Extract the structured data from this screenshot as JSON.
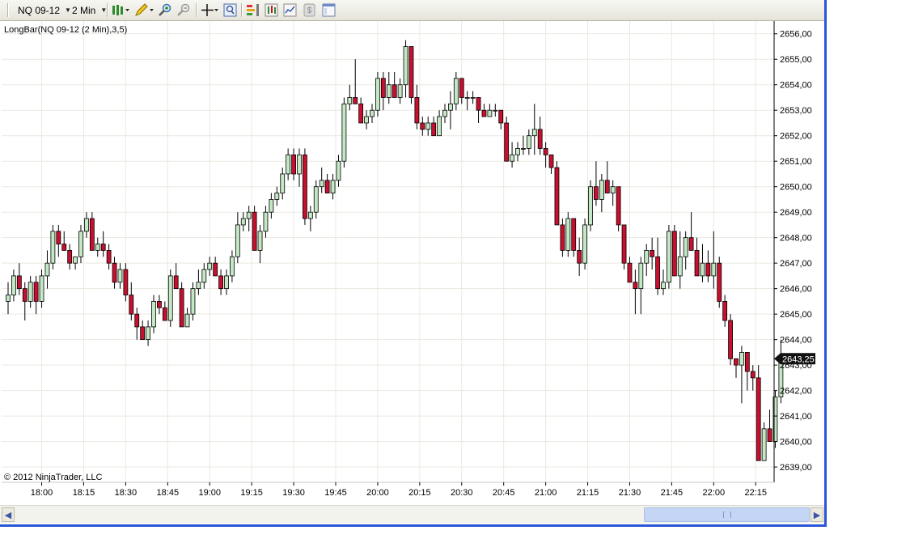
{
  "toolbar": {
    "instrument": "NQ 09-12",
    "interval": "2 Min",
    "icons": [
      "bar-type-icon",
      "drawing-pencil-icon",
      "zoom-in-icon",
      "zoom-out-icon",
      "crosshair-icon",
      "data-box-icon",
      "strategies-icon",
      "indicators-icon",
      "chart-style-icon",
      "price-marker-icon",
      "properties-icon"
    ]
  },
  "chart": {
    "indicator_label": "LongBar(NQ 09-12 (2 Min),3,5)",
    "copyright": "© 2012 NinjaTrader, LLC",
    "last_price": "2643,25",
    "colors": {
      "up": "#c4e8c4",
      "down": "#c8102e",
      "grid": "#e9e9e1",
      "last_price_bg": "#111111"
    }
  },
  "chart_data": {
    "type": "candlestick",
    "ylim": [
      2638.4,
      2656.5
    ],
    "y_ticks": [
      "2656,00",
      "2655,00",
      "2654,00",
      "2653,00",
      "2652,00",
      "2651,00",
      "2650,00",
      "2649,00",
      "2648,00",
      "2647,00",
      "2646,00",
      "2645,00",
      "2644,00",
      "2643,00",
      "2642,00",
      "2641,00",
      "2640,00",
      "2639,00"
    ],
    "x_ticks": [
      "18:00",
      "18:15",
      "18:30",
      "18:45",
      "19:00",
      "19:15",
      "19:30",
      "19:45",
      "20:00",
      "20:15",
      "20:30",
      "20:45",
      "21:00",
      "21:15",
      "21:30",
      "21:45",
      "22:00",
      "22:15"
    ],
    "x_tick_values": [
      0,
      7.5,
      15,
      22.5,
      30,
      37.5,
      45,
      52.5,
      60,
      67.5,
      75,
      82.5,
      90,
      97.5,
      105,
      112.5,
      120,
      127.5
    ],
    "x_range": [
      -6,
      130.5
    ],
    "candles": [
      [
        -6,
        2645.5,
        2646.25,
        2645.0,
        2645.75
      ],
      [
        -5,
        2645.75,
        2646.75,
        2645.5,
        2646.5
      ],
      [
        -4,
        2646.5,
        2647.0,
        2645.75,
        2646.0
      ],
      [
        -3,
        2646.0,
        2646.25,
        2644.75,
        2645.5
      ],
      [
        -2,
        2645.5,
        2646.5,
        2645.25,
        2646.25
      ],
      [
        -1,
        2646.25,
        2646.5,
        2645.0,
        2645.5
      ],
      [
        0,
        2645.5,
        2646.75,
        2645.25,
        2646.5
      ],
      [
        1,
        2646.5,
        2647.5,
        2646.0,
        2647.0
      ],
      [
        2,
        2647.0,
        2648.5,
        2646.75,
        2648.25
      ],
      [
        3,
        2648.25,
        2648.5,
        2647.25,
        2647.75
      ],
      [
        4,
        2647.75,
        2648.25,
        2647.5,
        2647.5
      ],
      [
        5,
        2647.5,
        2647.75,
        2646.75,
        2647.0
      ],
      [
        6,
        2647.0,
        2647.25,
        2646.75,
        2647.25
      ],
      [
        7,
        2647.25,
        2648.5,
        2647.0,
        2648.25
      ],
      [
        8,
        2648.25,
        2649.0,
        2648.0,
        2648.75
      ],
      [
        9,
        2648.75,
        2649.0,
        2647.5,
        2647.5
      ],
      [
        10,
        2647.5,
        2648.0,
        2647.25,
        2647.75
      ],
      [
        11,
        2647.75,
        2648.25,
        2647.25,
        2647.5
      ],
      [
        12,
        2647.5,
        2647.75,
        2646.75,
        2647.0
      ],
      [
        13,
        2647.0,
        2647.25,
        2646.0,
        2646.25
      ],
      [
        14,
        2646.25,
        2647.0,
        2646.0,
        2646.75
      ],
      [
        15,
        2646.75,
        2647.0,
        2645.5,
        2645.75
      ],
      [
        16,
        2645.75,
        2646.25,
        2644.75,
        2645.0
      ],
      [
        17,
        2645.0,
        2645.25,
        2644.0,
        2644.5
      ],
      [
        18,
        2644.5,
        2644.75,
        2644.0,
        2644.0
      ],
      [
        19,
        2644.0,
        2644.75,
        2643.75,
        2644.5
      ],
      [
        20,
        2644.5,
        2645.75,
        2644.25,
        2645.5
      ],
      [
        21,
        2645.5,
        2645.75,
        2645.0,
        2645.25
      ],
      [
        22,
        2645.25,
        2645.5,
        2644.75,
        2644.75
      ],
      [
        23,
        2644.75,
        2646.75,
        2644.5,
        2646.5
      ],
      [
        24,
        2646.5,
        2647.0,
        2646.0,
        2646.0
      ],
      [
        25,
        2646.0,
        2646.25,
        2644.5,
        2644.5
      ],
      [
        26,
        2644.5,
        2645.25,
        2644.5,
        2645.0
      ],
      [
        27,
        2645.0,
        2646.25,
        2644.75,
        2646.0
      ],
      [
        28,
        2646.0,
        2646.75,
        2645.75,
        2646.25
      ],
      [
        29,
        2646.25,
        2647.0,
        2646.0,
        2646.75
      ],
      [
        30,
        2646.75,
        2647.25,
        2646.5,
        2647.0
      ],
      [
        31,
        2647.0,
        2647.25,
        2646.5,
        2646.5
      ],
      [
        32,
        2646.5,
        2646.75,
        2645.75,
        2646.0
      ],
      [
        33,
        2646.0,
        2646.75,
        2645.75,
        2646.5
      ],
      [
        34,
        2646.5,
        2647.5,
        2646.25,
        2647.25
      ],
      [
        35,
        2647.25,
        2649.0,
        2647.0,
        2648.5
      ],
      [
        36,
        2648.5,
        2649.0,
        2648.25,
        2648.75
      ],
      [
        37,
        2648.75,
        2649.25,
        2648.25,
        2649.0
      ],
      [
        38,
        2649.0,
        2649.25,
        2647.5,
        2647.5
      ],
      [
        39,
        2647.5,
        2648.5,
        2647.0,
        2648.25
      ],
      [
        40,
        2648.25,
        2649.25,
        2648.0,
        2649.0
      ],
      [
        41,
        2649.0,
        2649.75,
        2648.75,
        2649.5
      ],
      [
        42,
        2649.5,
        2650.0,
        2649.25,
        2649.75
      ],
      [
        43,
        2649.75,
        2650.75,
        2649.5,
        2650.5
      ],
      [
        44,
        2650.5,
        2651.5,
        2650.25,
        2651.25
      ],
      [
        45,
        2651.25,
        2651.5,
        2650.25,
        2650.5
      ],
      [
        46,
        2650.5,
        2651.5,
        2650.0,
        2651.25
      ],
      [
        47,
        2651.25,
        2651.5,
        2648.5,
        2648.75
      ],
      [
        48,
        2648.75,
        2649.25,
        2648.25,
        2649.0
      ],
      [
        49,
        2649.0,
        2650.25,
        2648.75,
        2650.0
      ],
      [
        50,
        2650.0,
        2650.75,
        2649.75,
        2650.25
      ],
      [
        51,
        2650.25,
        2650.5,
        2649.75,
        2649.75
      ],
      [
        52,
        2649.75,
        2650.5,
        2649.5,
        2650.25
      ],
      [
        53,
        2650.25,
        2651.25,
        2650.0,
        2651.0
      ],
      [
        54,
        2651.0,
        2653.5,
        2650.75,
        2653.25
      ],
      [
        55,
        2653.25,
        2654.0,
        2653.0,
        2653.5
      ],
      [
        56,
        2653.5,
        2655.0,
        2653.25,
        2653.25
      ],
      [
        57,
        2653.25,
        2653.5,
        2652.5,
        2652.5
      ],
      [
        58,
        2652.5,
        2653.0,
        2652.25,
        2652.75
      ],
      [
        59,
        2652.75,
        2653.25,
        2652.5,
        2653.0
      ],
      [
        60,
        2653.0,
        2654.5,
        2652.75,
        2654.25
      ],
      [
        61,
        2654.25,
        2654.5,
        2653.0,
        2653.5
      ],
      [
        62,
        2653.5,
        2654.5,
        2653.25,
        2654.0
      ],
      [
        63,
        2654.0,
        2654.5,
        2653.5,
        2653.5
      ],
      [
        64,
        2653.5,
        2654.25,
        2653.25,
        2654.0
      ],
      [
        65,
        2654.0,
        2655.75,
        2653.5,
        2655.5
      ],
      [
        66,
        2655.5,
        2655.5,
        2653.25,
        2653.5
      ],
      [
        67,
        2653.5,
        2654.0,
        2652.25,
        2652.5
      ],
      [
        68,
        2652.5,
        2652.75,
        2652.0,
        2652.25
      ],
      [
        69,
        2652.25,
        2652.75,
        2652.0,
        2652.5
      ],
      [
        70,
        2652.5,
        2652.75,
        2652.0,
        2652.0
      ],
      [
        71,
        2652.0,
        2653.0,
        2652.0,
        2652.75
      ],
      [
        72,
        2652.75,
        2653.25,
        2652.5,
        2653.0
      ],
      [
        73,
        2653.0,
        2653.75,
        2652.25,
        2653.25
      ],
      [
        74,
        2653.25,
        2654.5,
        2653.0,
        2654.25
      ],
      [
        75,
        2654.25,
        2654.25,
        2653.25,
        2653.5
      ],
      [
        76,
        2653.5,
        2653.75,
        2653.0,
        2653.5
      ],
      [
        77,
        2653.5,
        2653.75,
        2653.25,
        2653.5
      ],
      [
        78,
        2653.5,
        2653.5,
        2652.5,
        2653.0
      ],
      [
        79,
        2653.0,
        2653.25,
        2652.75,
        2652.75
      ],
      [
        80,
        2652.75,
        2653.25,
        2652.75,
        2653.0
      ],
      [
        81,
        2653.0,
        2653.25,
        2652.75,
        2653.0
      ],
      [
        82,
        2653.0,
        2653.0,
        2652.25,
        2652.5
      ],
      [
        83,
        2652.5,
        2652.75,
        2651.0,
        2651.0
      ],
      [
        84,
        2651.0,
        2651.75,
        2650.75,
        2651.25
      ],
      [
        85,
        2651.25,
        2651.75,
        2651.0,
        2651.5
      ],
      [
        86,
        2651.5,
        2652.0,
        2651.25,
        2651.5
      ],
      [
        87,
        2651.5,
        2652.25,
        2651.25,
        2652.0
      ],
      [
        88,
        2652.0,
        2653.25,
        2651.25,
        2652.25
      ],
      [
        89,
        2652.25,
        2652.75,
        2651.25,
        2651.5
      ],
      [
        90,
        2651.5,
        2651.75,
        2650.75,
        2651.25
      ],
      [
        91,
        2651.25,
        2651.25,
        2650.5,
        2650.75
      ],
      [
        92,
        2650.75,
        2651.0,
        2648.5,
        2648.5
      ],
      [
        93,
        2648.5,
        2648.75,
        2647.25,
        2647.5
      ],
      [
        94,
        2647.5,
        2649.0,
        2647.25,
        2648.75
      ],
      [
        95,
        2648.75,
        2648.75,
        2647.25,
        2647.5
      ],
      [
        96,
        2647.5,
        2648.0,
        2646.5,
        2647.0
      ],
      [
        97,
        2647.0,
        2648.75,
        2646.75,
        2648.5
      ],
      [
        98,
        2648.5,
        2650.25,
        2648.25,
        2650.0
      ],
      [
        99,
        2650.0,
        2651.0,
        2649.25,
        2649.5
      ],
      [
        100,
        2649.5,
        2650.5,
        2649.0,
        2650.25
      ],
      [
        101,
        2650.25,
        2651.0,
        2649.75,
        2649.75
      ],
      [
        102,
        2649.75,
        2650.25,
        2649.25,
        2650.0
      ],
      [
        103,
        2650.0,
        2650.0,
        2648.25,
        2648.5
      ],
      [
        104,
        2648.5,
        2648.5,
        2646.75,
        2647.0
      ],
      [
        105,
        2647.0,
        2647.25,
        2646.25,
        2646.25
      ],
      [
        106,
        2646.25,
        2646.75,
        2645.0,
        2646.0
      ],
      [
        107,
        2646.0,
        2647.25,
        2645.0,
        2647.0
      ],
      [
        108,
        2647.0,
        2647.75,
        2646.5,
        2647.5
      ],
      [
        109,
        2647.5,
        2648.0,
        2646.75,
        2647.25
      ],
      [
        110,
        2647.25,
        2648.0,
        2645.75,
        2646.0
      ],
      [
        111,
        2646.0,
        2646.75,
        2645.75,
        2646.25
      ],
      [
        112,
        2646.25,
        2648.5,
        2646.0,
        2648.25
      ],
      [
        113,
        2648.25,
        2648.5,
        2646.5,
        2646.5
      ],
      [
        114,
        2646.5,
        2648.25,
        2646.0,
        2647.25
      ],
      [
        115,
        2647.25,
        2648.25,
        2646.75,
        2648.0
      ],
      [
        116,
        2648.0,
        2649.0,
        2647.5,
        2647.5
      ],
      [
        117,
        2647.5,
        2648.0,
        2646.5,
        2646.5
      ],
      [
        118,
        2646.5,
        2647.75,
        2646.25,
        2647.0
      ],
      [
        119,
        2647.0,
        2647.5,
        2646.25,
        2646.5
      ],
      [
        120,
        2646.5,
        2648.25,
        2646.0,
        2647.0
      ],
      [
        121,
        2647.0,
        2647.25,
        2645.25,
        2645.5
      ],
      [
        122,
        2645.5,
        2645.75,
        2644.5,
        2644.75
      ],
      [
        123,
        2644.75,
        2645.0,
        2643.0,
        2643.25
      ],
      [
        124,
        2643.25,
        2643.25,
        2642.5,
        2643.0
      ],
      [
        125,
        2643.0,
        2643.75,
        2641.5,
        2643.5
      ],
      [
        126,
        2643.5,
        2643.5,
        2642.0,
        2642.75
      ],
      [
        127,
        2642.75,
        2643.0,
        2642.0,
        2642.5
      ],
      [
        128,
        2642.5,
        2643.0,
        2639.25,
        2639.25
      ],
      [
        129,
        2639.25,
        2640.75,
        2639.25,
        2640.5
      ],
      [
        130,
        2640.5,
        2641.25,
        2640.0,
        2640.0
      ],
      [
        131,
        2640.0,
        2642.0,
        2639.75,
        2641.75
      ],
      [
        132,
        2641.75,
        2644.0,
        2641.5,
        2643.25
      ]
    ]
  }
}
